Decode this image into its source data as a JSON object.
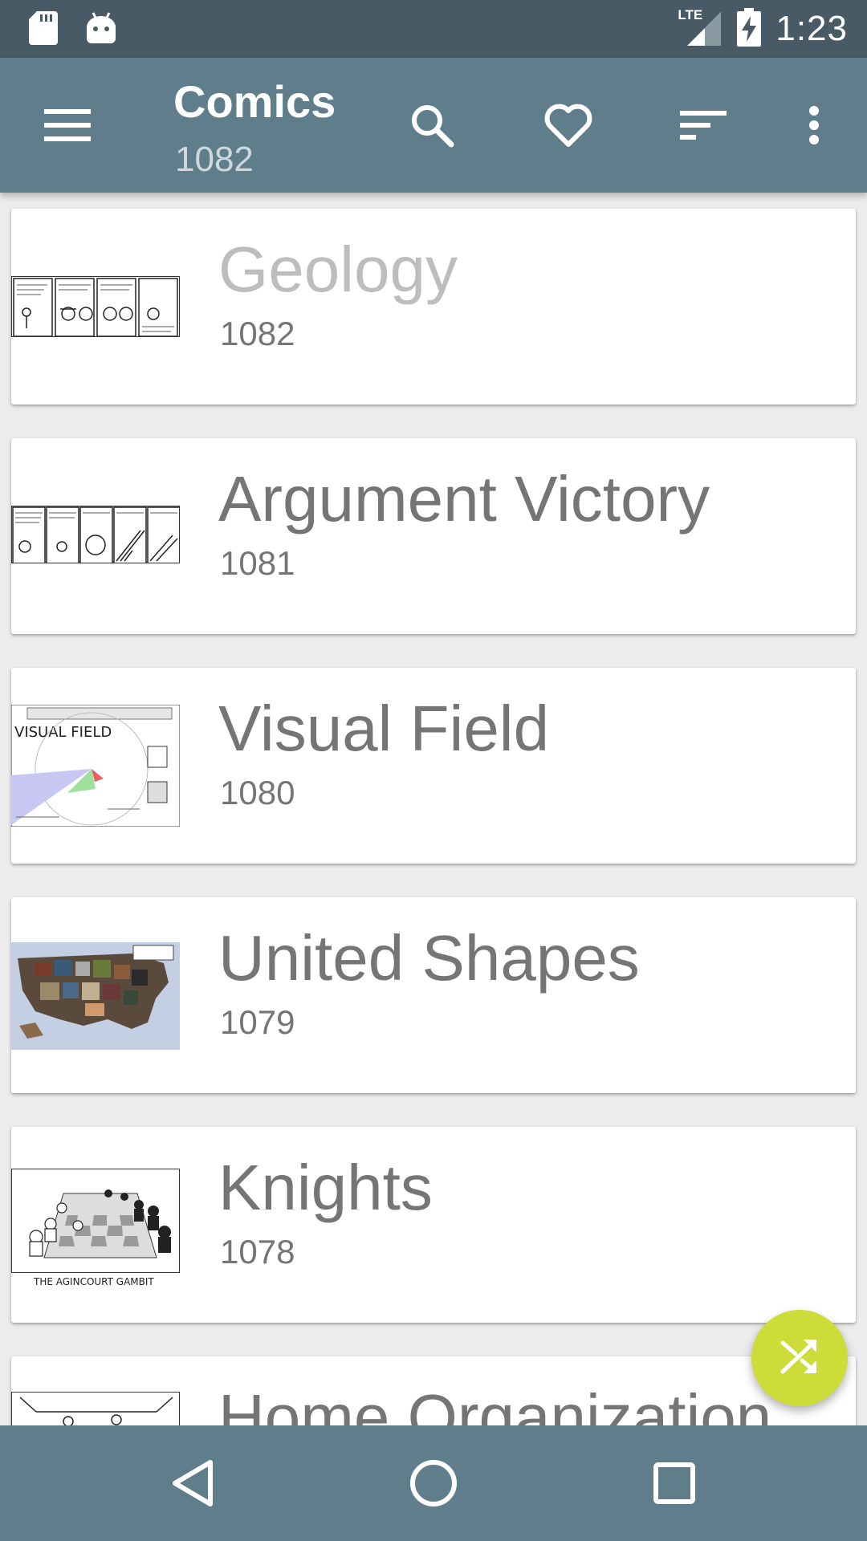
{
  "status_bar": {
    "time": "1:23",
    "network": "LTE",
    "icons": [
      "sd-card-icon",
      "android-icon",
      "signal-icon",
      "battery-charging-icon"
    ]
  },
  "app_bar": {
    "title": "Comics",
    "subtitle": "1082",
    "actions": [
      "menu-icon",
      "search-icon",
      "heart-icon",
      "sort-icon",
      "more-vert-icon"
    ]
  },
  "comics": [
    {
      "title": "Geology",
      "number": "1082",
      "read": true
    },
    {
      "title": "Argument Victory",
      "number": "1081",
      "read": false
    },
    {
      "title": "Visual Field",
      "number": "1080",
      "read": false
    },
    {
      "title": "United Shapes",
      "number": "1079",
      "read": false
    },
    {
      "title": "Knights",
      "number": "1078",
      "read": false,
      "thumb_caption": "THE AGINCOURT GAMBIT"
    },
    {
      "title": "Home Organization",
      "number": "",
      "read": false
    }
  ],
  "fab": {
    "icon": "shuffle-icon",
    "color": "#cddc39"
  },
  "nav_bar": {
    "icons": [
      "back-icon",
      "home-icon",
      "recents-icon"
    ]
  },
  "colors": {
    "status_bar": "#475a65",
    "app_bar": "#607d8b",
    "nav_bar": "#607d8b",
    "background": "#ececec",
    "title_text": "#757575",
    "read_title_text": "#bdbdbd"
  }
}
